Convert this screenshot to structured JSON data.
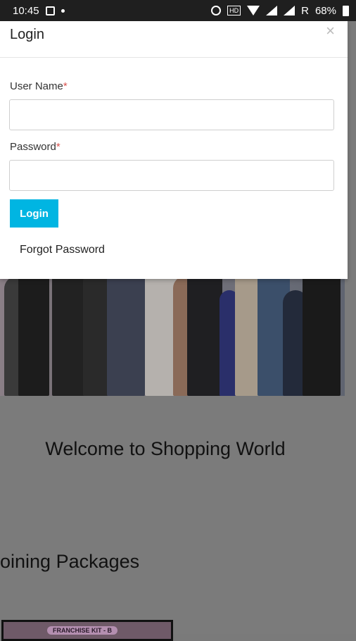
{
  "status_bar": {
    "time": "10:45",
    "carrier_indicator": "R",
    "battery": "68%",
    "icons": [
      "gallery-icon",
      "dot-icon",
      "alarm-icon",
      "hd-icon",
      "wifi-icon",
      "signal-icon",
      "signal-icon",
      "battery-icon"
    ],
    "hd_label": "HD"
  },
  "modal": {
    "title": "Login",
    "close_glyph": "×",
    "username": {
      "label": "User Name",
      "required_mark": "*",
      "value": "",
      "placeholder": ""
    },
    "password": {
      "label": "Password",
      "required_mark": "*",
      "value": "",
      "placeholder": ""
    },
    "login_button": "Login",
    "forgot_password": "Forgot Password"
  },
  "page": {
    "welcome_heading": "Welcome to Shopping World",
    "packages_heading": "oining Packages",
    "package_label": "FRANCHISE KIT - B"
  },
  "colors": {
    "accent": "#00b5e2",
    "required": "#d9534f",
    "overlay": "#7b7b7b"
  }
}
